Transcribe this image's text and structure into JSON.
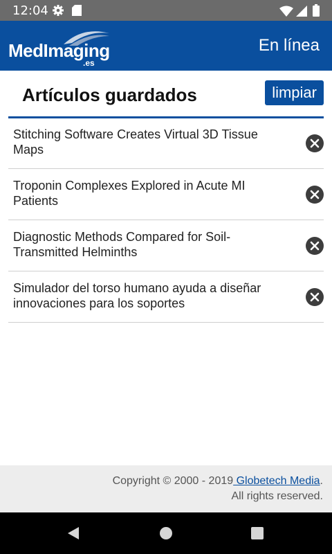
{
  "status_bar": {
    "time": "12:04"
  },
  "app_bar": {
    "logo_text": "MedImaging",
    "logo_tld": ".es",
    "connection_status": "En línea"
  },
  "saved": {
    "title": "Artículos guardados",
    "clear_label": "limpiar",
    "articles": [
      {
        "title": "Stitching Software Creates Virtual 3D Tissue Maps"
      },
      {
        "title": "Troponin Complexes Explored in Acute MI Patients"
      },
      {
        "title": "Diagnostic Methods Compared for Soil-Transmitted Helminths"
      },
      {
        "title": "Simulador del torso humano ayuda a diseñar innovaciones para los soportes"
      }
    ]
  },
  "footer": {
    "copyright_prefix": "Copyright © 2000 - 2019",
    "company_link": " Globetech Media",
    "period": ".",
    "rights": "All rights reserved."
  },
  "colors": {
    "brand": "#0a4f9e",
    "status_bar": "#6b6b6b",
    "footer_bg": "#ededed"
  }
}
